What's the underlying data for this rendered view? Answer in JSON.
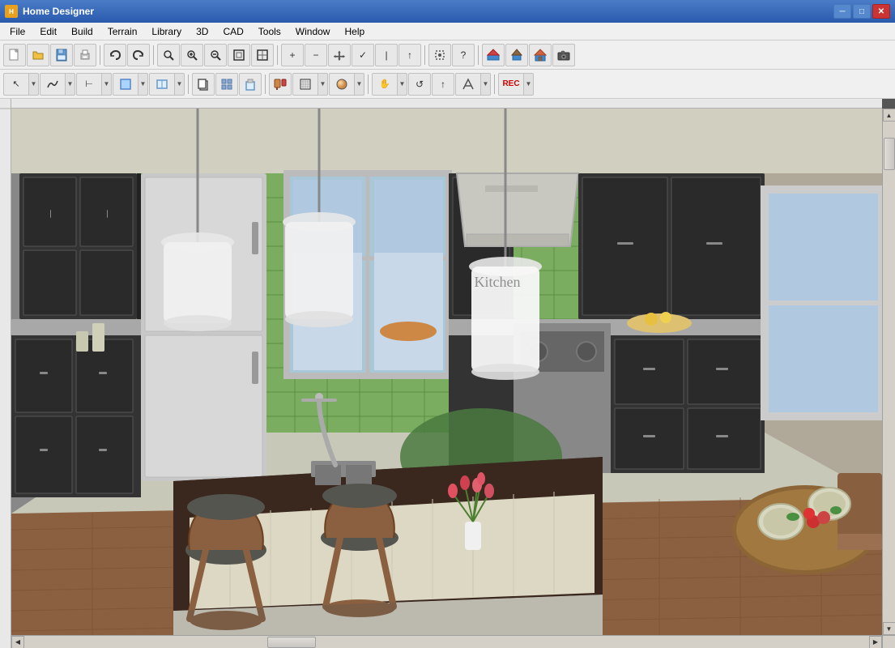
{
  "titleBar": {
    "title": "Home Designer",
    "icon": "HD",
    "controls": {
      "minimize": "─",
      "maximize": "□",
      "close": "✕"
    }
  },
  "menuBar": {
    "items": [
      {
        "id": "file",
        "label": "File"
      },
      {
        "id": "edit",
        "label": "Edit"
      },
      {
        "id": "build",
        "label": "Build"
      },
      {
        "id": "terrain",
        "label": "Terrain"
      },
      {
        "id": "library",
        "label": "Library"
      },
      {
        "id": "3d",
        "label": "3D"
      },
      {
        "id": "cad",
        "label": "CAD"
      },
      {
        "id": "tools",
        "label": "Tools"
      },
      {
        "id": "window",
        "label": "Window"
      },
      {
        "id": "help",
        "label": "Help"
      }
    ]
  },
  "toolbar1": {
    "buttons": [
      {
        "id": "new",
        "icon": "📄",
        "tooltip": "New"
      },
      {
        "id": "open",
        "icon": "📂",
        "tooltip": "Open"
      },
      {
        "id": "save",
        "icon": "💾",
        "tooltip": "Save"
      },
      {
        "id": "print",
        "icon": "🖨",
        "tooltip": "Print"
      },
      {
        "id": "undo",
        "icon": "↩",
        "tooltip": "Undo"
      },
      {
        "id": "redo",
        "icon": "↪",
        "tooltip": "Redo"
      },
      {
        "id": "zoom-in-glass",
        "icon": "🔍",
        "tooltip": "Zoom In"
      },
      {
        "id": "zoom-in-plus",
        "icon": "⊕",
        "tooltip": "Zoom In"
      },
      {
        "id": "zoom-out",
        "icon": "⊖",
        "tooltip": "Zoom Out"
      },
      {
        "id": "fit",
        "icon": "⊞",
        "tooltip": "Fit to View"
      },
      {
        "id": "actual",
        "icon": "⊡",
        "tooltip": "Actual Size"
      },
      {
        "id": "add",
        "icon": "+",
        "tooltip": "Add"
      },
      {
        "id": "subtract",
        "icon": "−",
        "tooltip": "Subtract"
      },
      {
        "id": "move",
        "icon": "✈",
        "tooltip": "Move"
      },
      {
        "id": "check",
        "icon": "✓",
        "tooltip": "Check"
      },
      {
        "id": "line",
        "icon": "|",
        "tooltip": "Line"
      },
      {
        "id": "arrow",
        "icon": "↑",
        "tooltip": "Arrow"
      },
      {
        "id": "snap",
        "icon": "⊞",
        "tooltip": "Snap"
      },
      {
        "id": "help-btn",
        "icon": "?",
        "tooltip": "Help"
      },
      {
        "id": "wall",
        "icon": "🏠",
        "tooltip": "Wall"
      },
      {
        "id": "roof",
        "icon": "⌂",
        "tooltip": "Roof"
      },
      {
        "id": "house",
        "icon": "🏡",
        "tooltip": "House"
      },
      {
        "id": "camera",
        "icon": "📷",
        "tooltip": "Camera"
      }
    ]
  },
  "toolbar2": {
    "buttons": [
      {
        "id": "select",
        "icon": "↖",
        "tooltip": "Select"
      },
      {
        "id": "polyline",
        "icon": "∿",
        "tooltip": "Polyline"
      },
      {
        "id": "dimension",
        "icon": "⊢",
        "tooltip": "Dimension"
      },
      {
        "id": "fill",
        "icon": "▦",
        "tooltip": "Fill"
      },
      {
        "id": "cabinet",
        "icon": "▣",
        "tooltip": "Cabinet"
      },
      {
        "id": "fixture",
        "icon": "⌂",
        "tooltip": "Fixture"
      },
      {
        "id": "copy",
        "icon": "⧉",
        "tooltip": "Copy"
      },
      {
        "id": "component",
        "icon": "⊞",
        "tooltip": "Component"
      },
      {
        "id": "paste",
        "icon": "📋",
        "tooltip": "Paste"
      },
      {
        "id": "paint",
        "icon": "🖌",
        "tooltip": "Paint"
      },
      {
        "id": "texture",
        "icon": "▤",
        "tooltip": "Texture"
      },
      {
        "id": "material",
        "icon": "🎨",
        "tooltip": "Material"
      },
      {
        "id": "grab",
        "icon": "✋",
        "tooltip": "Grab"
      },
      {
        "id": "rotate-obj",
        "icon": "↺",
        "tooltip": "Rotate Object"
      },
      {
        "id": "up-arrow",
        "icon": "↑",
        "tooltip": "Up"
      },
      {
        "id": "transform",
        "icon": "⤢",
        "tooltip": "Transform"
      },
      {
        "id": "record",
        "icon": "⏺",
        "tooltip": "Record"
      }
    ]
  },
  "canvas": {
    "backgroundColor": "#808080",
    "rulerColor": "#e8e8e8"
  },
  "statusBar": {
    "scrollH": 300,
    "scrollV": 20
  }
}
